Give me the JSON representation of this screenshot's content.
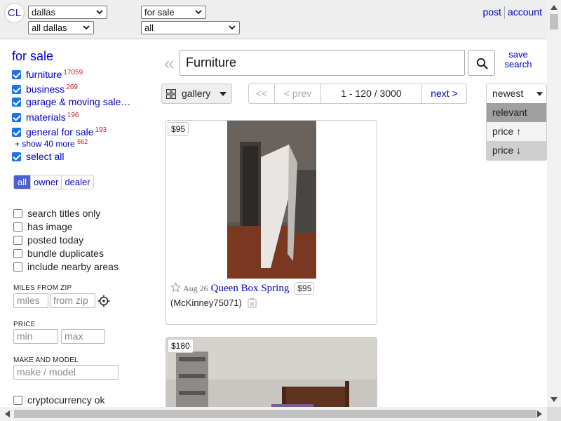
{
  "header": {
    "logo": "CL",
    "area_select": "dallas",
    "subarea_select": "all dallas",
    "category_select": "for sale",
    "subcategory_select": "all",
    "post_link": "post",
    "account_link": "account"
  },
  "sidebar": {
    "heading": "for sale",
    "categories": [
      {
        "label": "furniture",
        "count": "17059"
      },
      {
        "label": "business",
        "count": "269"
      },
      {
        "label": "garage & moving sale…",
        "count": ""
      },
      {
        "label": "materials",
        "count": "196"
      },
      {
        "label": "general for sale",
        "count": "193"
      }
    ],
    "show_more": "show 40 more",
    "show_more_count": "562",
    "select_all": "select all",
    "seller_types": [
      "all",
      "owner",
      "dealer"
    ],
    "options": [
      "search titles only",
      "has image",
      "posted today",
      "bundle duplicates",
      "include nearby areas"
    ],
    "miles_heading": "MILES FROM ZIP",
    "miles_placeholder": "miles",
    "zip_placeholder": "from zip",
    "price_heading": "PRICE",
    "min_placeholder": "min",
    "max_placeholder": "max",
    "make_heading": "MAKE AND MODEL",
    "make_placeholder": "make / model",
    "crypto": "cryptocurrency ok"
  },
  "search": {
    "query": "Furniture",
    "save_label": "save search"
  },
  "toolbar": {
    "view_label": "gallery",
    "first": "<<",
    "prev": "< prev",
    "range": "1 - 120 / 3000",
    "next": "next >",
    "sort_options": [
      "newest",
      "relevant",
      "price ↑",
      "price ↓"
    ]
  },
  "results": [
    {
      "price": "$95",
      "date": "Aug 26",
      "title": "Queen Box Spring",
      "hood": "(McKinney75071)"
    },
    {
      "price": "$180"
    }
  ]
}
